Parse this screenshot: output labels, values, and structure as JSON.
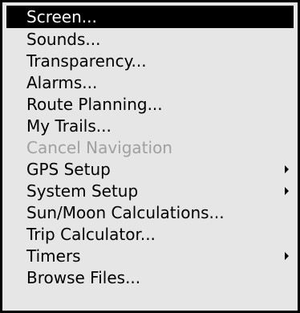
{
  "menu": {
    "items": [
      {
        "label": "Screen...",
        "selected": true,
        "disabled": false,
        "submenu": false
      },
      {
        "label": "Sounds...",
        "selected": false,
        "disabled": false,
        "submenu": false
      },
      {
        "label": "Transparency...",
        "selected": false,
        "disabled": false,
        "submenu": false
      },
      {
        "label": "Alarms...",
        "selected": false,
        "disabled": false,
        "submenu": false
      },
      {
        "label": "Route Planning...",
        "selected": false,
        "disabled": false,
        "submenu": false
      },
      {
        "label": "My Trails...",
        "selected": false,
        "disabled": false,
        "submenu": false
      },
      {
        "label": "Cancel Navigation",
        "selected": false,
        "disabled": true,
        "submenu": false
      },
      {
        "label": "GPS Setup",
        "selected": false,
        "disabled": false,
        "submenu": true
      },
      {
        "label": "System Setup",
        "selected": false,
        "disabled": false,
        "submenu": true
      },
      {
        "label": "Sun/Moon Calculations...",
        "selected": false,
        "disabled": false,
        "submenu": false
      },
      {
        "label": "Trip Calculator...",
        "selected": false,
        "disabled": false,
        "submenu": false
      },
      {
        "label": "Timers",
        "selected": false,
        "disabled": false,
        "submenu": true
      },
      {
        "label": "Browse Files...",
        "selected": false,
        "disabled": false,
        "submenu": false
      }
    ]
  },
  "colors": {
    "background": "#e6e6e6",
    "border": "#000000",
    "selected_bg": "#000000",
    "selected_text": "#ffffff",
    "disabled_text": "#a0a0a0"
  }
}
